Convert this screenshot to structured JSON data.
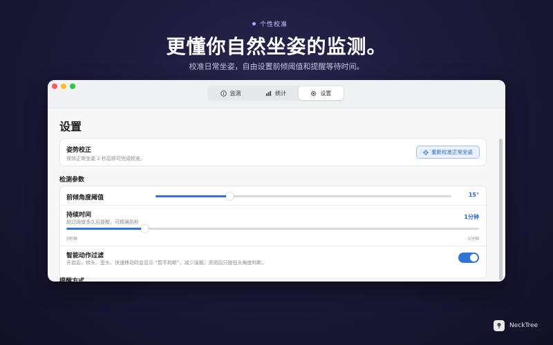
{
  "hero": {
    "badge": "个性校准",
    "title": "更懂你自然坐姿的监测。",
    "subtitle": "校准日常坐姿，自由设置前倾阈值和提醒等待时间。"
  },
  "tabs": [
    {
      "label": "监测",
      "icon": "info-icon",
      "active": false
    },
    {
      "label": "统计",
      "icon": "bar-chart-icon",
      "active": false
    },
    {
      "label": "设置",
      "icon": "gear-icon",
      "active": true
    }
  ],
  "page": {
    "title": "设置"
  },
  "posture": {
    "title": "姿势校正",
    "subtitle": "保持正常坐姿 2 秒后即可完成校准。",
    "button_label": "重新校准正常坐姿"
  },
  "detection": {
    "section_title": "检测参数",
    "threshold": {
      "label": "前倾角度阈值",
      "value": "15°",
      "fraction": 0.25
    },
    "duration": {
      "label": "持续时间",
      "hint": "超过阈值多久后提醒，可精确到秒",
      "value": "1分钟",
      "fraction": 0.19,
      "min_label": "5秒钟",
      "max_label": "5分钟"
    },
    "smart_filter": {
      "label": "智能动作过滤",
      "hint": "开启后，转头、歪头、快速移动时会显示 “暂不判断”，减少误报；关闭后只按低头角度判断。",
      "enabled": true
    }
  },
  "reminder": {
    "section_title": "提醒方式"
  },
  "brand": {
    "name": "NeckTree"
  },
  "colors": {
    "accent": "#2f73d8",
    "background": "#1b1a3a"
  }
}
